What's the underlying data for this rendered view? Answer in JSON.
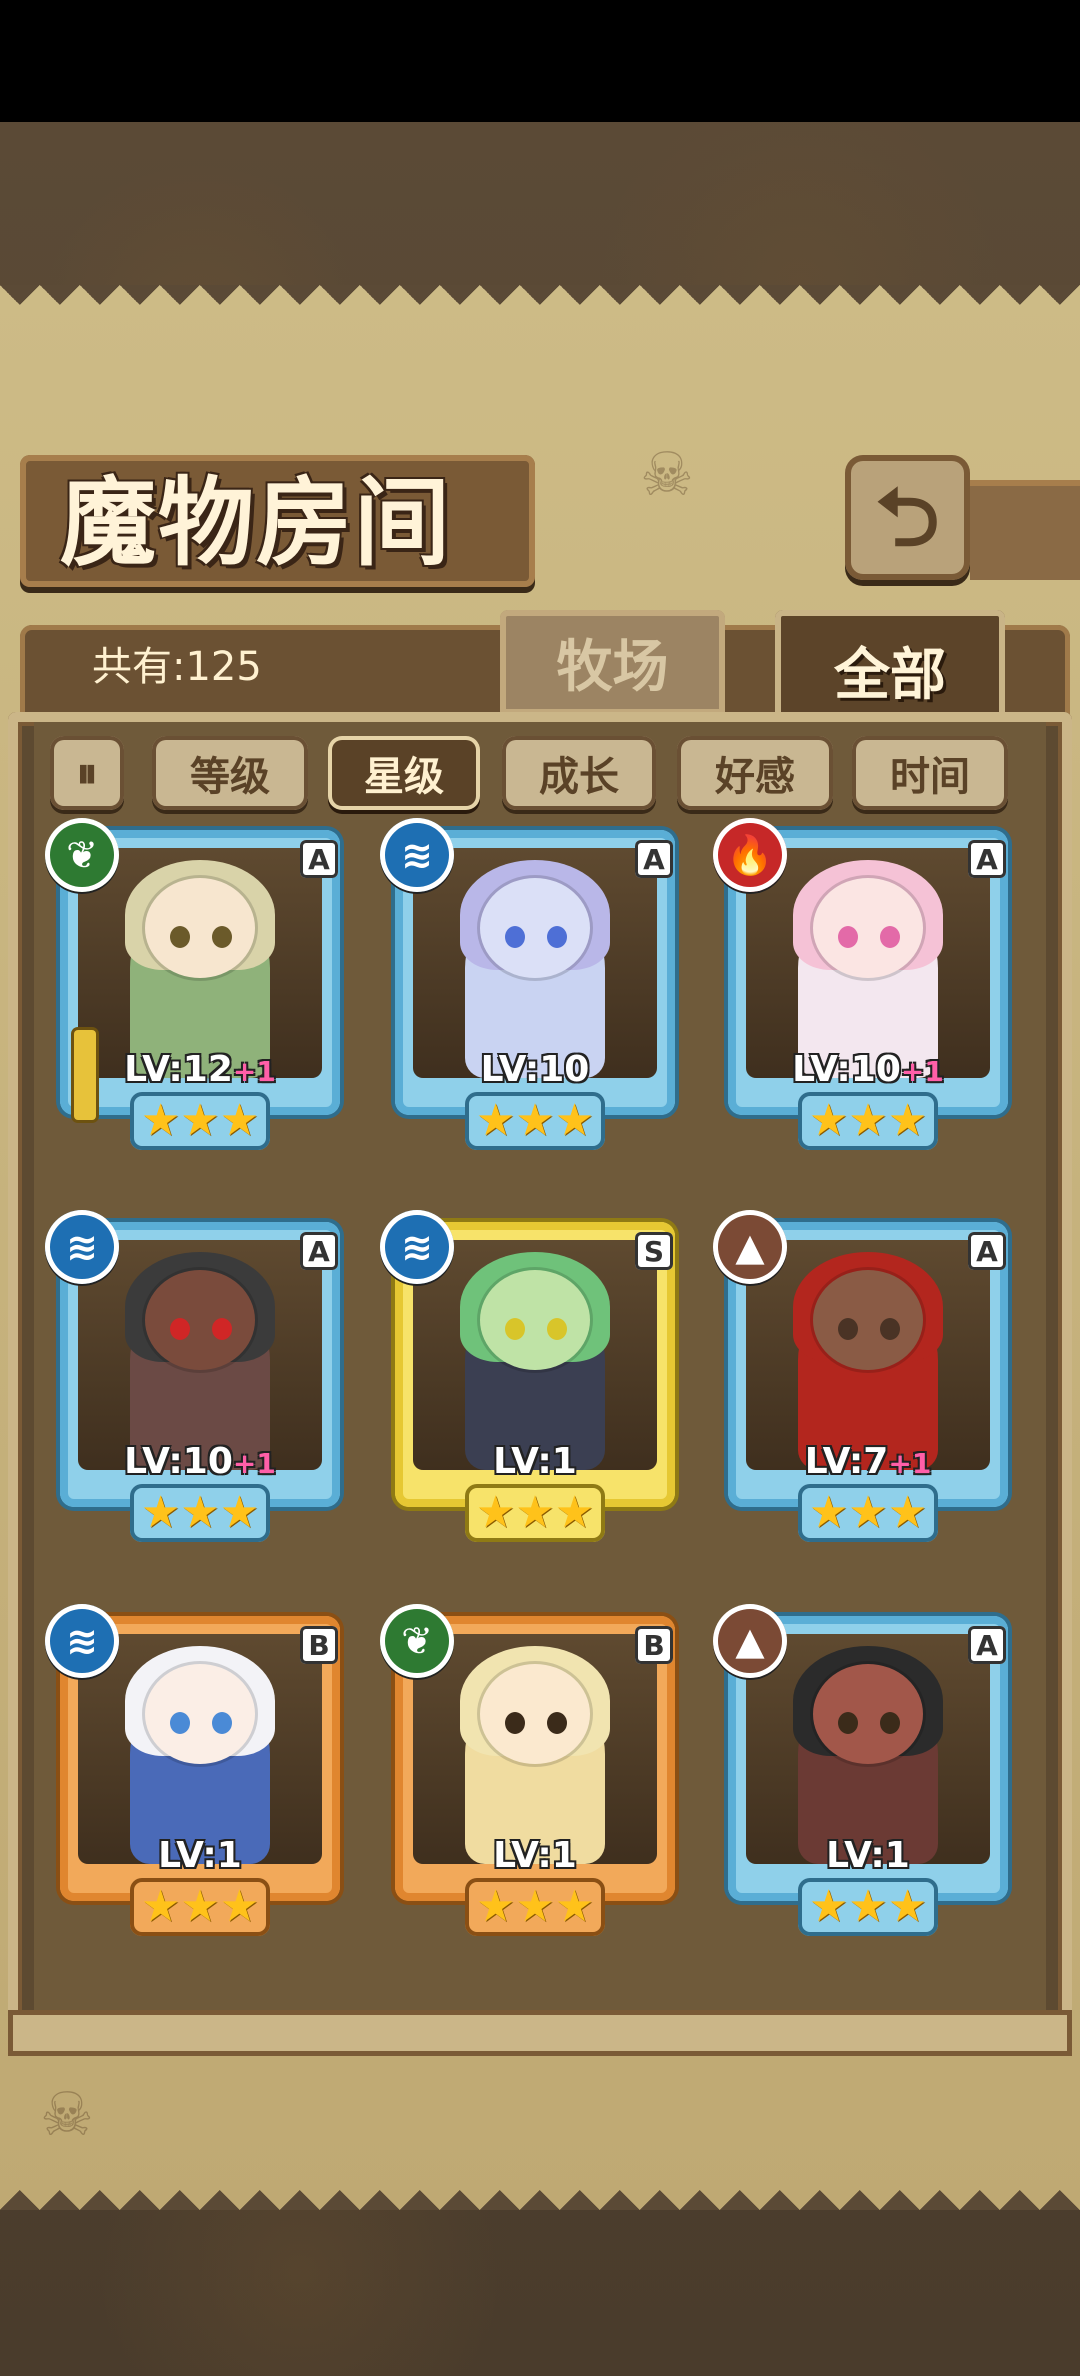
{
  "title": "魔物房间",
  "count_text": "共有:125",
  "tabs": {
    "farm": "牧场",
    "all": "全部"
  },
  "back_icon": "return-arrow-icon",
  "sort_buttons": [
    "等级",
    "星级",
    "成长",
    "好感",
    "时间"
  ],
  "sort_active": "星级",
  "monsters": [
    {
      "element": "nature",
      "grade": "A",
      "level": "LV:12",
      "bonus": "+1",
      "stars": "★★★",
      "rarity": "A",
      "weapon": true
    },
    {
      "element": "water",
      "grade": "A",
      "level": "LV:10",
      "bonus": "",
      "stars": "★★★",
      "rarity": "A",
      "weapon": false
    },
    {
      "element": "fire",
      "grade": "A",
      "level": "LV:10",
      "bonus": "+1",
      "stars": "★★★",
      "rarity": "A",
      "weapon": false
    },
    {
      "element": "water",
      "grade": "A",
      "level": "LV:10",
      "bonus": "+1",
      "stars": "★★★",
      "rarity": "A",
      "weapon": false
    },
    {
      "element": "water",
      "grade": "S",
      "level": "LV:1",
      "bonus": "",
      "stars": "★★★",
      "rarity": "S",
      "weapon": false
    },
    {
      "element": "earth",
      "grade": "A",
      "level": "LV:7",
      "bonus": "+1",
      "stars": "★★★",
      "rarity": "A",
      "weapon": false
    },
    {
      "element": "water",
      "grade": "B",
      "level": "LV:1",
      "bonus": "",
      "stars": "★★★",
      "rarity": "B",
      "weapon": false
    },
    {
      "element": "nature",
      "grade": "B",
      "level": "LV:1",
      "bonus": "",
      "stars": "★★★",
      "rarity": "B",
      "weapon": false
    },
    {
      "element": "earth",
      "grade": "A",
      "level": "LV:1",
      "bonus": "",
      "stars": "★★★",
      "rarity": "A",
      "weapon": false
    }
  ],
  "colors": {
    "nature": "#2e7a32",
    "water": "#1e6fb3",
    "fire": "#c62828",
    "earth": "#7b4a35",
    "rarity_A": "#8fd0ea",
    "rarity_S": "#f7e36a",
    "rarity_B": "#f2a95a"
  }
}
